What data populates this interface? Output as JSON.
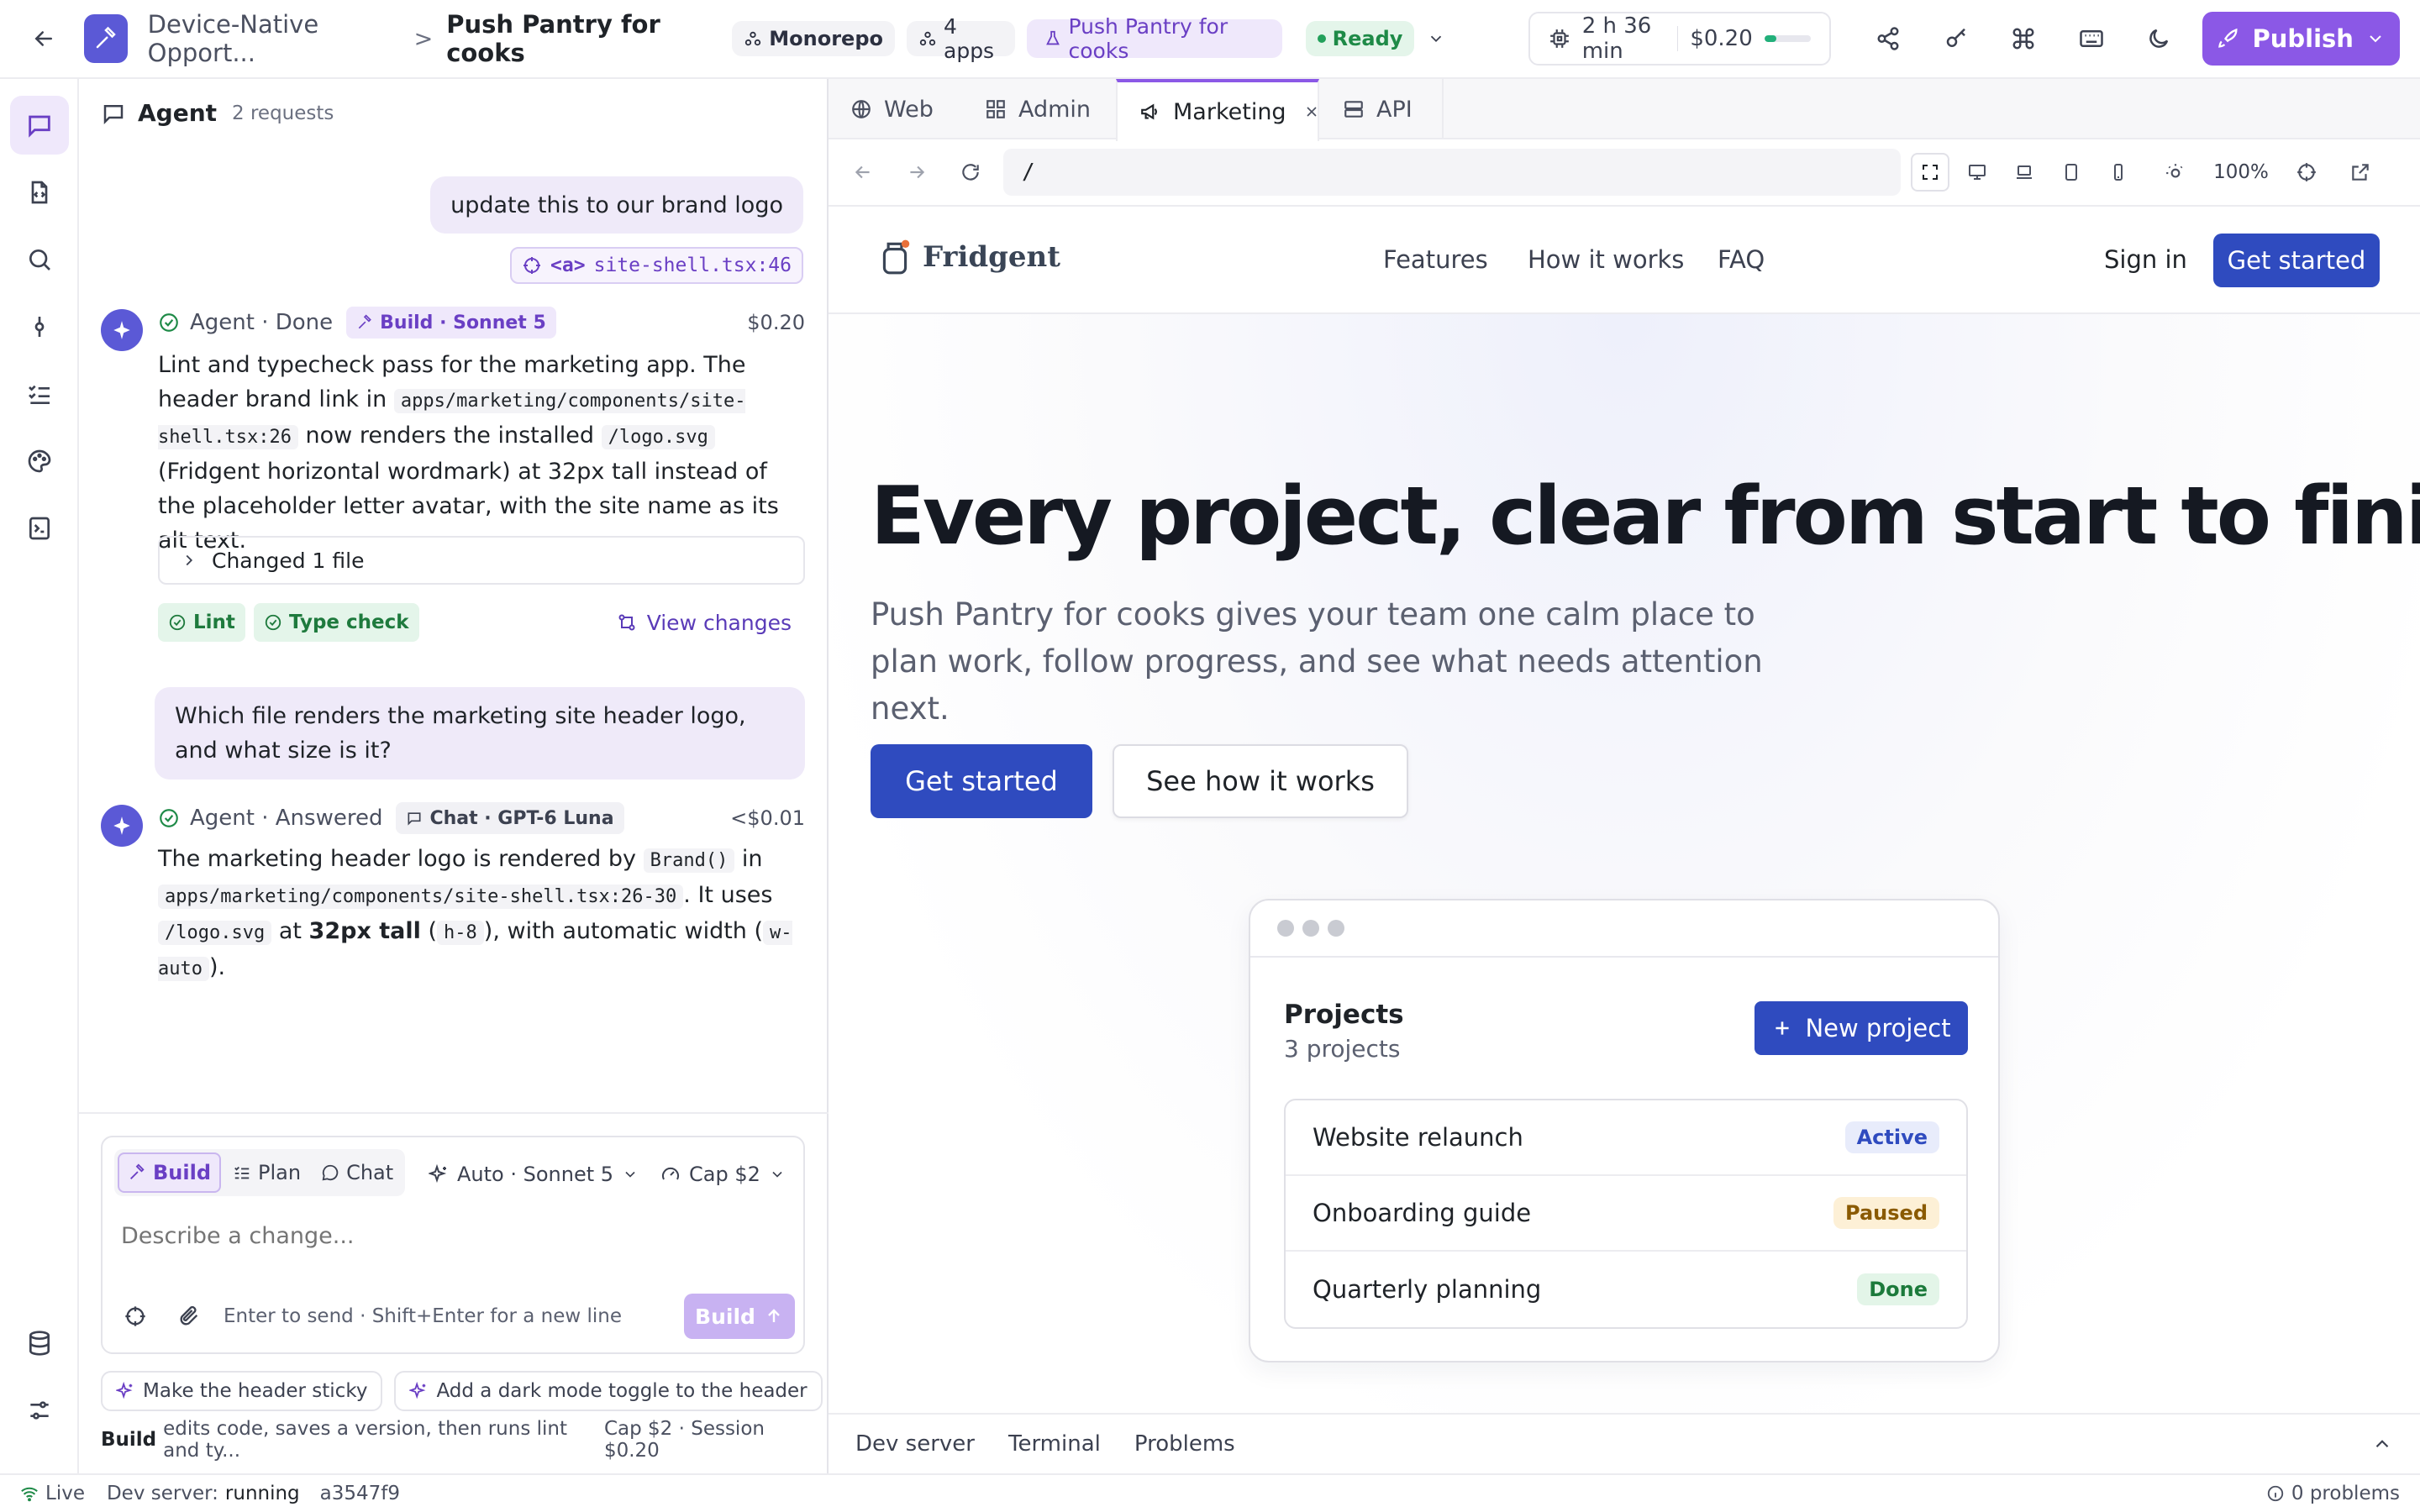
{
  "topbar": {
    "breadcrumb_project": "Device-Native Opport...",
    "breadcrumb_separator": ">",
    "breadcrumb_current": "Push Pantry for cooks",
    "repo_badge": "Monorepo",
    "apps_badge": "4 apps",
    "app_badge": "Push Pantry for cooks",
    "status": "Ready",
    "time": "2 h 36 min",
    "cost": "$0.20",
    "cost_progress": 0.25,
    "publish_label": "Publish"
  },
  "agent": {
    "title": "Agent",
    "requests": "2 requests",
    "user_msg_1": "update this to our brand logo",
    "element_ref_tag": "<a>",
    "element_ref_file": "site-shell.tsx:46",
    "reply1": {
      "status": "Agent · Done",
      "mode_badge": "Build · Sonnet 5",
      "cost": "$0.20",
      "t1": "Lint and typecheck pass for the marketing app. The header brand link in",
      "code1": "apps/marketing/components/site-shell.tsx:26",
      "t2": "now renders the installed",
      "code2": "/logo.svg",
      "t3": "(Fridgent horizontal wordmark) at 32px tall instead of the placeholder letter avatar, with the site name as its alt text.",
      "changed_files": "Changed 1 file",
      "check_lint": "Lint",
      "check_type": "Type check",
      "view_changes": "View changes"
    },
    "user_msg_2": "Which file renders the marketing site header logo, and what size is it?",
    "reply2": {
      "status": "Agent · Answered",
      "mode_badge": "Chat · GPT-6 Luna",
      "cost": "<$0.01",
      "t1": "The marketing header logo is rendered by",
      "code1": "Brand()",
      "t2": "in",
      "code2": "apps/marketing/components/site-shell.tsx:26-30",
      "t3": ". It uses",
      "code3": "/logo.svg",
      "t4": "at",
      "bold": "32px tall",
      "t5": "(",
      "code4": "h-8",
      "t6": "), with automatic width (",
      "code5": "w-auto",
      "t7": ")."
    },
    "composer": {
      "mode_build": "Build",
      "mode_plan": "Plan",
      "mode_chat": "Chat",
      "model": "Auto · Sonnet 5",
      "cap": "Cap $2",
      "placeholder": "Describe a change...",
      "hint": "Enter to send · Shift+Enter for a new line",
      "send_label": "Build"
    },
    "suggestions": [
      "Make the header sticky",
      "Add a dark mode toggle to the header"
    ],
    "footer_bold": "Build",
    "footer_text": "edits code, saves a version, then runs lint and ty...",
    "footer_cap": "Cap $2 · Session $0.20"
  },
  "preview": {
    "tabs": [
      "Web",
      "Admin",
      "Marketing",
      "API"
    ],
    "active_tab": "Marketing",
    "url": "/",
    "zoom": "100%",
    "site": {
      "brand": "Fridgent",
      "nav": [
        "Features",
        "How it works",
        "FAQ"
      ],
      "sign_in": "Sign in",
      "get_started": "Get started",
      "hero_title": "Every project, clear from start to finish",
      "hero_sub": "Push Pantry for cooks gives your team one calm place to plan work, follow progress, and see what needs attention next.",
      "cta_primary": "Get started",
      "cta_secondary": "See how it works",
      "card": {
        "title": "Projects",
        "subtitle": "3 projects",
        "new_button": "New project",
        "rows": [
          {
            "name": "Website relaunch",
            "status": "Active",
            "color": "#2f4bbf",
            "bg": "#e8ecfb"
          },
          {
            "name": "Onboarding guide",
            "status": "Paused",
            "color": "#8a5a00",
            "bg": "#fdf0d6"
          },
          {
            "name": "Quarterly planning",
            "status": "Done",
            "color": "#1c7a3b",
            "bg": "#e3f5e8"
          }
        ]
      }
    },
    "bottom_tabs": [
      "Dev server",
      "Terminal",
      "Problems"
    ]
  },
  "statusbar": {
    "live": "Live",
    "dev_label": "Dev server:",
    "dev_state": "running",
    "commit": "a3547f9",
    "problems": "0 problems"
  },
  "colors": {
    "accent": "#7c4ddb",
    "brand_blue": "#2f4bbf",
    "ready_green": "#1e8a47"
  }
}
